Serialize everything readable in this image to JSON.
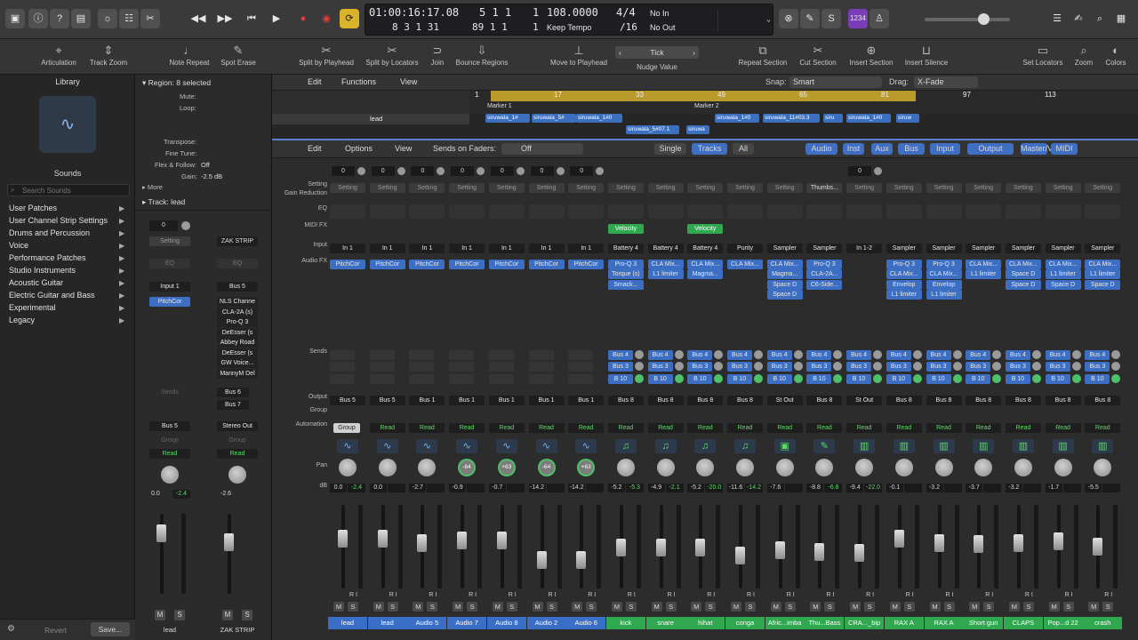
{
  "control_bar": {
    "lcd": {
      "position_time": "01:00:16:17.08",
      "position_time_sub": "8 3 1 31",
      "bars": "5 1 1",
      "bars_sub": "89 1 1",
      "beat": "1",
      "beat_sub": "1",
      "tempo": "108.0000",
      "tempo_mode": "Keep Tempo",
      "signature": "4/4",
      "division": "/16",
      "midi_in": "No In",
      "midi_out": "No Out"
    },
    "key_badge": "1234"
  },
  "toolbar": {
    "items": [
      "Articulation",
      "Track Zoom",
      "Note Repeat",
      "Spot Erase",
      "Split by Playhead",
      "Split by Locators",
      "Join",
      "Bounce Regions",
      "Move to Playhead",
      "Tick",
      "Nudge Value",
      "Repeat Section",
      "Cut Section",
      "Insert Section",
      "Insert Silence",
      "Set Locators",
      "Zoom",
      "Colors"
    ]
  },
  "library": {
    "title": "Library",
    "sounds_label": "Sounds",
    "search_placeholder": "Search Sounds",
    "items": [
      "User Patches",
      "User Channel Strip Settings",
      "Drums and Percussion",
      "Voice",
      "Performance Patches",
      "Studio Instruments",
      "Acoustic Guitar",
      "Electric Guitar and Bass",
      "Experimental",
      "Legacy"
    ],
    "revert": "Revert",
    "save": "Save..."
  },
  "inspector": {
    "region": "Region: 8 selected",
    "mute": "Mute:",
    "loop": "Loop:",
    "transpose": "Transpose:",
    "fine_tune": "Fine Tune:",
    "flex": "Flex & Follow:",
    "flex_val": "Off",
    "gain": "Gain:",
    "gain_val": "-2.5 dB",
    "more": "More",
    "track": "Track:",
    "track_name": "lead",
    "strip_a": {
      "vol_top": "0",
      "setting": "Setting",
      "eq": "EQ",
      "input": "Input 1",
      "plugin": "PitchCor",
      "sends": "Sends",
      "output": "Bus 5",
      "group": "Group",
      "auto": "Read",
      "db": "0.0",
      "peak": "-2.4",
      "name": "lead"
    },
    "strip_b": {
      "setting": "ZAK STRIP",
      "eq": "EQ",
      "input": "Bus 5",
      "plugins": [
        "NLS Channe",
        "CLA-2A (s)",
        "Pro-Q 3",
        "DeEsser (s",
        "Abbey Road",
        "DeEsser (s",
        "GW Voice...",
        "MannyM Del"
      ],
      "send1": "Bus 6",
      "send2": "Bus 7",
      "output": "Stereo Out",
      "group": "Group",
      "auto": "Read",
      "db": "-2.6",
      "name": "ZAK STRIP"
    }
  },
  "tracks_area": {
    "menus": [
      "Edit",
      "Functions",
      "View"
    ],
    "snap_label": "Snap:",
    "snap_value": "Smart",
    "drag_label": "Drag:",
    "drag_value": "X-Fade",
    "ruler": [
      "1",
      "17",
      "33",
      "49",
      "65",
      "81",
      "97",
      "113"
    ],
    "markers": [
      "Marker 1",
      "Marker 2"
    ],
    "track_name": "lead",
    "regions": [
      "siruwala_1#",
      "siruwala_5#",
      "siruwala_1#0",
      "siruwala_1#0",
      "siruwala_11#03.3",
      "siru",
      "siruwala_1#0",
      "siruw",
      "siruwala_5#07.1",
      "siruwa"
    ]
  },
  "mixer": {
    "menus": [
      "Edit",
      "Options",
      "View"
    ],
    "sends_on_faders": "Sends on Faders:",
    "sends_value": "Off",
    "modes": [
      "Single",
      "Tracks",
      "All"
    ],
    "filters": [
      "Audio",
      "Inst",
      "Aux",
      "Bus",
      "Input",
      "Output",
      "Master/VCA",
      "MIDI"
    ],
    "row_labels": {
      "setting": "Setting",
      "gain": "Gain Reduction",
      "eq": "EQ",
      "midifx": "MIDI FX",
      "input": "Input",
      "audiofx": "Audio FX",
      "sends": "Sends",
      "output": "Output",
      "group": "Group",
      "automation": "Automation",
      "pan": "Pan",
      "db": "dB"
    },
    "strips": [
      {
        "name": "lead",
        "color": "#3b6fc7",
        "input": "In 1",
        "fx": [
          "PitchCor"
        ],
        "sends": [],
        "output": "Bus 5",
        "group": "Group",
        "auto": "Read",
        "pan": "",
        "db": "0.0",
        "peak": "-2.4",
        "vol": "0",
        "icon": "wave",
        "fader": 0.62
      },
      {
        "name": "lead",
        "color": "#3b6fc7",
        "input": "In 1",
        "fx": [
          "PitchCor"
        ],
        "sends": [],
        "output": "Bus 5",
        "group": "",
        "auto": "Read",
        "pan": "",
        "db": "0.0",
        "peak": "",
        "vol": "0",
        "icon": "wave",
        "fader": 0.62
      },
      {
        "name": "Audio 5",
        "color": "#3b6fc7",
        "input": "In 1",
        "fx": [
          "PitchCor"
        ],
        "sends": [],
        "output": "Bus 1",
        "group": "",
        "auto": "Read",
        "pan": "",
        "db": "-2.7",
        "peak": "",
        "vol": "0",
        "icon": "wave",
        "fader": 0.55
      },
      {
        "name": "Audio 7",
        "color": "#3b6fc7",
        "input": "In 1",
        "fx": [
          "PitchCor"
        ],
        "sends": [],
        "output": "Bus 1",
        "group": "",
        "auto": "Read",
        "pan": "-64",
        "db": "-0.9",
        "peak": "",
        "vol": "0",
        "icon": "wave",
        "fader": 0.6
      },
      {
        "name": "Audio 8",
        "color": "#3b6fc7",
        "input": "In 1",
        "fx": [
          "PitchCor"
        ],
        "sends": [],
        "output": "Bus 1",
        "group": "",
        "auto": "Read",
        "pan": "+63",
        "db": "-0.7",
        "peak": "",
        "vol": "0",
        "icon": "wave",
        "fader": 0.6
      },
      {
        "name": "Audio 2",
        "color": "#3b6fc7",
        "input": "In 1",
        "fx": [
          "PitchCor"
        ],
        "sends": [],
        "output": "Bus 1",
        "group": "",
        "auto": "Read",
        "pan": "-64",
        "db": "-14.2",
        "peak": "",
        "vol": "0",
        "icon": "wave",
        "fader": 0.3
      },
      {
        "name": "Audio 6",
        "color": "#3b6fc7",
        "input": "In 1",
        "fx": [
          "PitchCor"
        ],
        "sends": [],
        "output": "Bus 1",
        "group": "",
        "auto": "Read",
        "pan": "+63",
        "db": "-14.2",
        "peak": "",
        "vol": "0",
        "icon": "wave",
        "fader": 0.3
      },
      {
        "name": "kick",
        "color": "#2fa84f",
        "midifx": "Velocity",
        "input": "Battery 4",
        "fx": [
          "Pro-Q 3",
          "Torque (s)",
          "Smack..."
        ],
        "sends": [
          "Bus 4",
          "Bus 3",
          "B 10"
        ],
        "output": "Bus 8",
        "group": "",
        "auto": "Read",
        "pan": "",
        "db": "-5.2",
        "peak": "-5.3",
        "vol": "",
        "icon": "note",
        "fader": 0.48
      },
      {
        "name": "snare",
        "color": "#2fa84f",
        "input": "Battery 4",
        "fx": [
          "CLA Mix...",
          "L1 limiter"
        ],
        "sends": [
          "Bus 4",
          "Bus 3",
          "B 10"
        ],
        "output": "Bus 8",
        "group": "",
        "auto": "Read",
        "pan": "",
        "db": "-4.9",
        "peak": "-2.1",
        "vol": "",
        "icon": "note",
        "fader": 0.49
      },
      {
        "name": "hihat",
        "color": "#2fa84f",
        "midifx": "Velocity",
        "input": "Battery 4",
        "fx": [
          "CLA Mix...",
          "Magma..."
        ],
        "sends": [
          "Bus 4",
          "Bus 3",
          "B 10"
        ],
        "output": "Bus 8",
        "group": "",
        "auto": "Read",
        "pan": "",
        "db": "-5.2",
        "peak": "-20.0",
        "vol": "",
        "icon": "note",
        "fader": 0.48
      },
      {
        "name": "conga",
        "color": "#2fa84f",
        "input": "Purity",
        "fx": [
          "CLA Mix..."
        ],
        "sends": [
          "Bus 4",
          "Bus 3",
          "B 10"
        ],
        "output": "Bus 8",
        "group": "",
        "auto": "Read",
        "pan": "",
        "db": "-11.6",
        "peak": "-14.2",
        "vol": "",
        "icon": "note",
        "fader": 0.36
      },
      {
        "name": "Afric...imba",
        "color": "#2fa84f",
        "input": "Sampler",
        "fx": [
          "CLA Mix...",
          "Magma...",
          "Space D",
          "Space D"
        ],
        "sends": [
          "Bus 4",
          "Bus 3",
          "B 10"
        ],
        "output": "St Out",
        "group": "",
        "auto": "Read",
        "pan": "",
        "db": "-7.6",
        "peak": "",
        "vol": "",
        "icon": "amp",
        "fader": 0.45
      },
      {
        "name": "Thu...Bass",
        "color": "#2fa84f",
        "setting": "Thumbs...",
        "input": "Sampler",
        "fx": [
          "Pro-Q 3",
          "CLA-2A...",
          "C6-Side..."
        ],
        "sends": [
          "Bus 4",
          "Bus 3",
          "B 10"
        ],
        "output": "Bus 8",
        "group": "",
        "auto": "Read",
        "pan": "",
        "db": "-8.8",
        "peak": "-6.8",
        "vol": "",
        "icon": "guitar",
        "fader": 0.42
      },
      {
        "name": "CRA..._bip",
        "color": "#2fa84f",
        "input": "In 1-2",
        "fx": [],
        "sends": [
          "Bus 4",
          "Bus 3",
          "B 10"
        ],
        "output": "St Out",
        "group": "",
        "auto": "Read",
        "pan": "",
        "db": "-9.4",
        "peak": "-22.0",
        "vol": "0",
        "icon": "eq",
        "fader": 0.4
      },
      {
        "name": "RAX A",
        "color": "#2fa84f",
        "input": "Sampler",
        "fx": [
          "Pro-Q 3",
          "CLA Mix...",
          "Envelop",
          "L1 limiter"
        ],
        "sends": [
          "Bus 4",
          "Bus 3",
          "B 10"
        ],
        "output": "Bus 8",
        "group": "",
        "auto": "Read",
        "pan": "",
        "db": "-0.1",
        "peak": "",
        "vol": "",
        "icon": "eq",
        "fader": 0.62
      },
      {
        "name": "RAX A",
        "color": "#2fa84f",
        "input": "Sampler",
        "fx": [
          "Pro-Q 3",
          "CLA Mix...",
          "Envelop",
          "L1 limiter"
        ],
        "sends": [
          "Bus 4",
          "Bus 3",
          "B 10"
        ],
        "output": "Bus 8",
        "group": "",
        "auto": "Read",
        "pan": "",
        "db": "-3.2",
        "peak": "",
        "vol": "",
        "icon": "eq",
        "fader": 0.55
      },
      {
        "name": "Short gun",
        "color": "#2fa84f",
        "input": "Sampler",
        "fx": [
          "CLA Mix...",
          "L1 limiter"
        ],
        "sends": [
          "Bus 4",
          "Bus 3",
          "B 10"
        ],
        "output": "Bus 8",
        "group": "",
        "auto": "Read",
        "pan": "",
        "db": "-3.7",
        "peak": "",
        "vol": "",
        "icon": "eq",
        "fader": 0.54
      },
      {
        "name": "CLAPS",
        "color": "#2fa84f",
        "input": "Sampler",
        "fx": [
          "CLA Mix...",
          "Space D",
          "Space D"
        ],
        "sends": [
          "Bus 4",
          "Bus 3",
          "B 10"
        ],
        "output": "Bus 8",
        "group": "",
        "auto": "Read",
        "pan": "",
        "db": "-3.2",
        "peak": "",
        "vol": "",
        "icon": "eq",
        "fader": 0.55
      },
      {
        "name": "Pop...d 22",
        "color": "#2fa84f",
        "input": "Sampler",
        "fx": [
          "CLA Mix...",
          "L1 limiter",
          "Space D"
        ],
        "sends": [
          "Bus 4",
          "Bus 3",
          "B 10"
        ],
        "output": "Bus 8",
        "group": "",
        "auto": "Read",
        "pan": "",
        "db": "-1.7",
        "peak": "",
        "vol": "",
        "icon": "eq",
        "fader": 0.58
      },
      {
        "name": "crash",
        "color": "#2fa84f",
        "input": "Sampler",
        "fx": [
          "CLA Mix...",
          "L1 limiter",
          "Space D"
        ],
        "sends": [
          "Bus 4",
          "Bus 3",
          "B 10"
        ],
        "output": "Bus 8",
        "group": "",
        "auto": "Read",
        "pan": "",
        "db": "-5.5",
        "peak": "",
        "vol": "",
        "icon": "eq",
        "fader": 0.5
      }
    ]
  }
}
